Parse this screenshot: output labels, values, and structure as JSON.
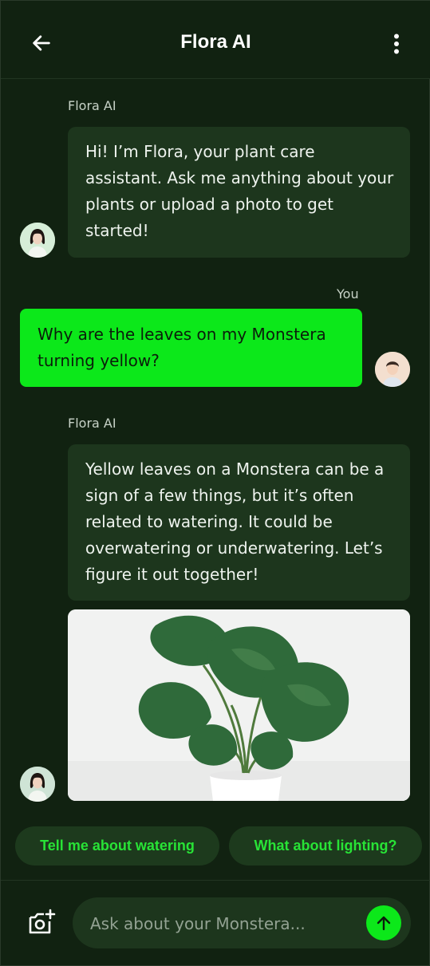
{
  "header": {
    "title": "Flora AI",
    "back_icon": "arrow-left-icon",
    "menu_icon": "more-vertical-icon"
  },
  "messages": [
    {
      "sender": "Flora AI",
      "role": "assistant",
      "text": "Hi! I’m Flora, your plant care assistant. Ask me anything about your plants or upload a photo to get started!"
    },
    {
      "sender": "You",
      "role": "user",
      "text": "Why are the leaves on my Monstera turning yellow?"
    },
    {
      "sender": "Flora AI",
      "role": "assistant",
      "text": "Yellow leaves on a Monstera can be a sign of a few things, but it’s often related to watering. It could be overwatering or underwatering. Let’s figure it out together!",
      "image": "monstera-plant-photo"
    }
  ],
  "suggestions": [
    "Tell me about watering",
    "What about lighting?"
  ],
  "composer": {
    "placeholder": "Ask about your Monstera...",
    "camera_icon": "add-photo-icon",
    "send_icon": "arrow-up-icon"
  },
  "colors": {
    "background": "#112211",
    "accent": "#0ce81a",
    "bubble": "#1d361d",
    "chip_text": "#28e336"
  }
}
